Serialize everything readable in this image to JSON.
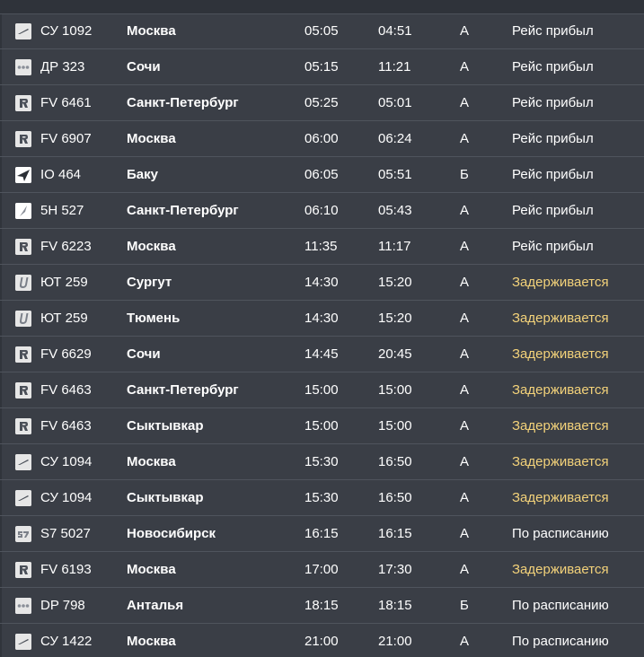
{
  "colors": {
    "background": "#3a3e46",
    "row_divider": "#4f545d",
    "text": "#ffffff",
    "delayed": "#f3d27a"
  },
  "flights": [
    {
      "logo": "aeroflot-logo",
      "flight": "СУ 1092",
      "city": "Москва",
      "scheduled": "05:05",
      "actual": "04:51",
      "terminal": "A",
      "status": "Рейс прибыл",
      "delayed": false
    },
    {
      "logo": "dots-logo",
      "flight": "ДР 323",
      "city": "Сочи",
      "scheduled": "05:15",
      "actual": "11:21",
      "terminal": "A",
      "status": "Рейс прибыл",
      "delayed": false
    },
    {
      "logo": "rossiya-logo",
      "flight": "FV 6461",
      "city": "Санкт-Петербург",
      "scheduled": "05:25",
      "actual": "05:01",
      "terminal": "A",
      "status": "Рейс прибыл",
      "delayed": false
    },
    {
      "logo": "rossiya-logo",
      "flight": "FV 6907",
      "city": "Москва",
      "scheduled": "06:00",
      "actual": "06:24",
      "terminal": "A",
      "status": "Рейс прибыл",
      "delayed": false
    },
    {
      "logo": "azal-logo",
      "flight": "IO 464",
      "city": "Баку",
      "scheduled": "06:05",
      "actual": "05:51",
      "terminal": "Б",
      "status": "Рейс прибыл",
      "delayed": false
    },
    {
      "logo": "feather-logo",
      "flight": "5H 527",
      "city": "Санкт-Петербург",
      "scheduled": "06:10",
      "actual": "05:43",
      "terminal": "A",
      "status": "Рейс прибыл",
      "delayed": false
    },
    {
      "logo": "rossiya-logo",
      "flight": "FV 6223",
      "city": "Москва",
      "scheduled": "11:35",
      "actual": "11:17",
      "terminal": "A",
      "status": "Рейс прибыл",
      "delayed": false
    },
    {
      "logo": "utair-logo",
      "flight": "ЮТ 259",
      "city": "Сургут",
      "scheduled": "14:30",
      "actual": "15:20",
      "terminal": "A",
      "status": "Задерживается",
      "delayed": true
    },
    {
      "logo": "utair-logo",
      "flight": "ЮТ 259",
      "city": "Тюмень",
      "scheduled": "14:30",
      "actual": "15:20",
      "terminal": "A",
      "status": "Задерживается",
      "delayed": true
    },
    {
      "logo": "rossiya-logo",
      "flight": "FV 6629",
      "city": "Сочи",
      "scheduled": "14:45",
      "actual": "20:45",
      "terminal": "A",
      "status": "Задерживается",
      "delayed": true
    },
    {
      "logo": "rossiya-logo",
      "flight": "FV 6463",
      "city": "Санкт-Петербург",
      "scheduled": "15:00",
      "actual": "15:00",
      "terminal": "A",
      "status": "Задерживается",
      "delayed": true
    },
    {
      "logo": "rossiya-logo",
      "flight": "FV 6463",
      "city": "Сыктывкар",
      "scheduled": "15:00",
      "actual": "15:00",
      "terminal": "A",
      "status": "Задерживается",
      "delayed": true
    },
    {
      "logo": "aeroflot-logo",
      "flight": "СУ 1094",
      "city": "Москва",
      "scheduled": "15:30",
      "actual": "16:50",
      "terminal": "A",
      "status": "Задерживается",
      "delayed": true
    },
    {
      "logo": "aeroflot-logo",
      "flight": "СУ 1094",
      "city": "Сыктывкар",
      "scheduled": "15:30",
      "actual": "16:50",
      "terminal": "A",
      "status": "Задерживается",
      "delayed": true
    },
    {
      "logo": "s7-logo",
      "flight": "S7 5027",
      "city": "Новосибирск",
      "scheduled": "16:15",
      "actual": "16:15",
      "terminal": "A",
      "status": "По расписанию",
      "delayed": false
    },
    {
      "logo": "rossiya-logo",
      "flight": "FV 6193",
      "city": "Москва",
      "scheduled": "17:00",
      "actual": "17:30",
      "terminal": "A",
      "status": "Задерживается",
      "delayed": true
    },
    {
      "logo": "dots-logo",
      "flight": "DP 798",
      "city": "Анталья",
      "scheduled": "18:15",
      "actual": "18:15",
      "terminal": "Б",
      "status": "По расписанию",
      "delayed": false
    },
    {
      "logo": "aeroflot-logo",
      "flight": "СУ 1422",
      "city": "Москва",
      "scheduled": "21:00",
      "actual": "21:00",
      "terminal": "A",
      "status": "По расписанию",
      "delayed": false
    }
  ]
}
